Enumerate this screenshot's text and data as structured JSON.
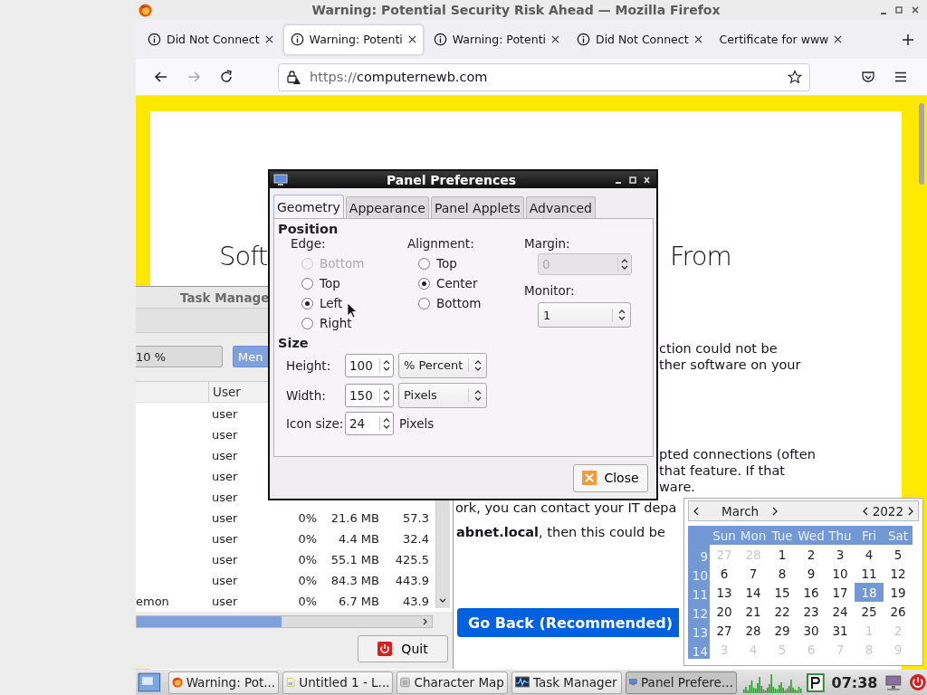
{
  "browser": {
    "title": "Warning: Potential Security Risk Ahead — Mozilla Firefox",
    "tabs": [
      {
        "label": "Did Not Connect",
        "selected": false
      },
      {
        "label": "Warning: Potenti",
        "selected": true
      },
      {
        "label": "Warning: Potenti",
        "selected": false
      },
      {
        "label": "Did Not Connect",
        "selected": false
      },
      {
        "label": "Certificate for www",
        "selected": false
      }
    ],
    "url": {
      "scheme": "https://",
      "host": "computernewb.com"
    },
    "page": {
      "heading": [
        "Soft",
        "From"
      ],
      "lines": [
        "ction could not be",
        "ther software on your",
        "pted connections (often",
        "that feature. If that",
        "ware.",
        "ork, you can contact your IT depa",
        "**abnet.local**, then this could be"
      ],
      "button": "Go Back (Recommended)"
    }
  },
  "task_manager": {
    "title": "Task Manage",
    "cpu_field": "10 %",
    "memory_button": "Men",
    "columns": [
      "User"
    ],
    "rows": [
      {
        "user": "user"
      },
      {
        "user": "user"
      },
      {
        "user": "user"
      },
      {
        "user": "user"
      },
      {
        "user": "user"
      },
      {
        "user": "user",
        "cpu": "0%",
        "memory": "21.6 MB",
        "column_5": "57.3"
      },
      {
        "user": "user",
        "cpu": "0%",
        "memory": "4.4 MB",
        "column_5": "32.4"
      },
      {
        "user": "user",
        "cpu": "0%",
        "memory": "55.1 MB",
        "column_5": "425.5"
      },
      {
        "user": "user",
        "cpu": "0%",
        "memory": "84.3 MB",
        "column_5": "443.9"
      },
      {
        "name": "emon",
        "user": "user",
        "cpu": "0%",
        "memory": "6.7 MB",
        "column_5": "43.9"
      }
    ],
    "quit": "Quit"
  },
  "panel_preferences": {
    "title": "Panel Preferences",
    "tabs": [
      {
        "label": "Geometry",
        "selected": true
      },
      {
        "label": "Appearance",
        "selected": false
      },
      {
        "label": "Panel Applets",
        "selected": false
      },
      {
        "label": "Advanced",
        "selected": false
      }
    ],
    "position": {
      "heading": "Position",
      "edge": {
        "label": "Edge:",
        "options": [
          {
            "label": "Bottom",
            "selected": false,
            "disabled": true
          },
          {
            "label": "Top",
            "selected": false,
            "disabled": false
          },
          {
            "label": "Left",
            "selected": true,
            "disabled": false
          },
          {
            "label": "Right",
            "selected": false,
            "disabled": false
          }
        ]
      },
      "alignment": {
        "label": "Alignment:",
        "options": [
          {
            "label": "Top",
            "selected": false
          },
          {
            "label": "Center",
            "selected": true
          },
          {
            "label": "Bottom",
            "selected": false
          }
        ]
      },
      "margin": {
        "label": "Margin:",
        "value": "0",
        "disabled": true
      },
      "monitor": {
        "label": "Monitor:",
        "value": "1"
      }
    },
    "size": {
      "heading": "Size",
      "fields": [
        {
          "label": "Height:",
          "value": "100",
          "unit": "% Percent",
          "kind": "combo"
        },
        {
          "label": "Width:",
          "value": "150",
          "unit": "Pixels",
          "kind": "combo"
        },
        {
          "label": "Icon size:",
          "value": "24",
          "unit": "Pixels",
          "kind": "text"
        }
      ]
    },
    "close": "Close"
  },
  "calendar": {
    "month": "March",
    "year": "2022",
    "weekdays": [
      "Sun",
      "Mon",
      "Tue",
      "Wed",
      "Thu",
      "Fri",
      "Sat"
    ],
    "weeks": [
      {
        "number": "9",
        "days": [
          {
            "day": "27",
            "outside": true,
            "selected": false
          },
          {
            "day": "28",
            "outside": true,
            "selected": false
          },
          {
            "day": "1",
            "outside": false,
            "selected": false
          },
          {
            "day": "2",
            "outside": false,
            "selected": false
          },
          {
            "day": "3",
            "outside": false,
            "selected": false
          },
          {
            "day": "4",
            "outside": false,
            "selected": false
          },
          {
            "day": "5",
            "outside": false,
            "selected": false
          }
        ]
      },
      {
        "number": "10",
        "days": [
          {
            "day": "6",
            "outside": false,
            "selected": false
          },
          {
            "day": "7",
            "outside": false,
            "selected": false
          },
          {
            "day": "8",
            "outside": false,
            "selected": false
          },
          {
            "day": "9",
            "outside": false,
            "selected": false
          },
          {
            "day": "10",
            "outside": false,
            "selected": false
          },
          {
            "day": "11",
            "outside": false,
            "selected": false
          },
          {
            "day": "12",
            "outside": false,
            "selected": false
          }
        ]
      },
      {
        "number": "11",
        "days": [
          {
            "day": "13",
            "outside": false,
            "selected": false
          },
          {
            "day": "14",
            "outside": false,
            "selected": false
          },
          {
            "day": "15",
            "outside": false,
            "selected": false
          },
          {
            "day": "16",
            "outside": false,
            "selected": false
          },
          {
            "day": "17",
            "outside": false,
            "selected": false
          },
          {
            "day": "18",
            "outside": false,
            "selected": true
          },
          {
            "day": "19",
            "outside": false,
            "selected": false
          }
        ]
      },
      {
        "number": "12",
        "days": [
          {
            "day": "20",
            "outside": false,
            "selected": false
          },
          {
            "day": "21",
            "outside": false,
            "selected": false
          },
          {
            "day": "22",
            "outside": false,
            "selected": false
          },
          {
            "day": "23",
            "outside": false,
            "selected": false
          },
          {
            "day": "24",
            "outside": false,
            "selected": false
          },
          {
            "day": "25",
            "outside": false,
            "selected": false
          },
          {
            "day": "26",
            "outside": false,
            "selected": false
          }
        ]
      },
      {
        "number": "13",
        "days": [
          {
            "day": "27",
            "outside": false,
            "selected": false
          },
          {
            "day": "28",
            "outside": false,
            "selected": false
          },
          {
            "day": "29",
            "outside": false,
            "selected": false
          },
          {
            "day": "30",
            "outside": false,
            "selected": false
          },
          {
            "day": "31",
            "outside": false,
            "selected": false
          },
          {
            "day": "1",
            "outside": true,
            "selected": false
          },
          {
            "day": "2",
            "outside": true,
            "selected": false
          }
        ]
      },
      {
        "number": "14",
        "days": [
          {
            "day": "3",
            "outside": true,
            "selected": false
          },
          {
            "day": "4",
            "outside": true,
            "selected": false
          },
          {
            "day": "5",
            "outside": true,
            "selected": false
          },
          {
            "day": "6",
            "outside": true,
            "selected": false
          },
          {
            "day": "7",
            "outside": true,
            "selected": false
          },
          {
            "day": "8",
            "outside": true,
            "selected": false
          },
          {
            "day": "9",
            "outside": true,
            "selected": false
          }
        ]
      }
    ]
  },
  "taskbar": {
    "items": [
      {
        "label": "Warning: Pot...",
        "selected": false
      },
      {
        "label": "Untitled 1 - L...",
        "selected": false
      },
      {
        "label": "Character Map",
        "selected": false
      },
      {
        "label": "Task Manager",
        "selected": false
      },
      {
        "label": "Panel Prefere...",
        "selected": true
      }
    ],
    "clock": "07:38"
  }
}
